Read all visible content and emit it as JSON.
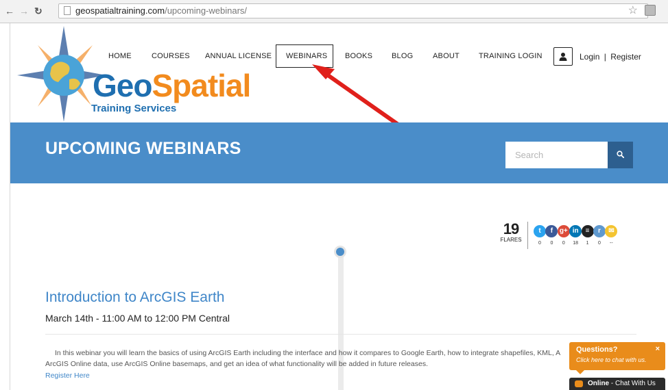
{
  "browser": {
    "url_domain": "geospatialtraining.com",
    "url_path": "/upcoming-webinars/",
    "back_icon": "back-arrow-icon",
    "forward_icon": "forward-arrow-icon",
    "reload_icon": "reload-icon",
    "bookmark_icon": "star-icon"
  },
  "logo": {
    "part1": "Geo",
    "part2": "Spatial",
    "tagline": "Training Services"
  },
  "nav": {
    "items": [
      "HOME",
      "COURSES",
      "ANNUAL LICENSE",
      "WEBINARS",
      "BOOKS",
      "BLOG",
      "ABOUT",
      "TRAINING LOGIN"
    ],
    "active": "WEBINARS",
    "login": "Login",
    "divider": "|",
    "register": "Register"
  },
  "banner": {
    "title": "UPCOMING WEBINARS",
    "search_placeholder": "Search"
  },
  "share": {
    "count": "19",
    "count_label": "FLARES",
    "buttons": [
      {
        "icon": "twitter-icon",
        "count": "0",
        "color": "#2aa3ef"
      },
      {
        "icon": "facebook-icon",
        "count": "0",
        "color": "#3b5998"
      },
      {
        "icon": "google-plus-icon",
        "count": "0",
        "color": "#dd4b39"
      },
      {
        "icon": "linkedin-icon",
        "count": "18",
        "color": "#0077b5"
      },
      {
        "icon": "buffer-icon",
        "count": "1",
        "color": "#222222"
      },
      {
        "icon": "reddit-icon",
        "count": "0",
        "color": "#5f99cf"
      },
      {
        "icon": "email-icon",
        "count": "--",
        "color": "#f4c430"
      }
    ]
  },
  "webinar": {
    "title": "Introduction to ArcGIS Earth",
    "date": "March 14th - 11:00 AM to 12:00 PM Central",
    "description": "In this webinar you will learn the basics of using ArcGIS Earth including the interface and how it compares to Google Earth, how to integrate shapefiles, KML, A ArcGIS Online data, use ArcGIS Online basemaps, and get an idea of what functionality will be added in future releases.",
    "register_link": "Register Here"
  },
  "chat": {
    "question": "Questions?",
    "close": "×",
    "hint": "Click here to chat with us.",
    "status": "Online",
    "status_rest": " - Chat With Us"
  },
  "colors": {
    "banner": "#4a8dc9",
    "accent_orange": "#f28b1e",
    "brand_blue": "#1f6fb0",
    "arrow": "#e0201b"
  }
}
